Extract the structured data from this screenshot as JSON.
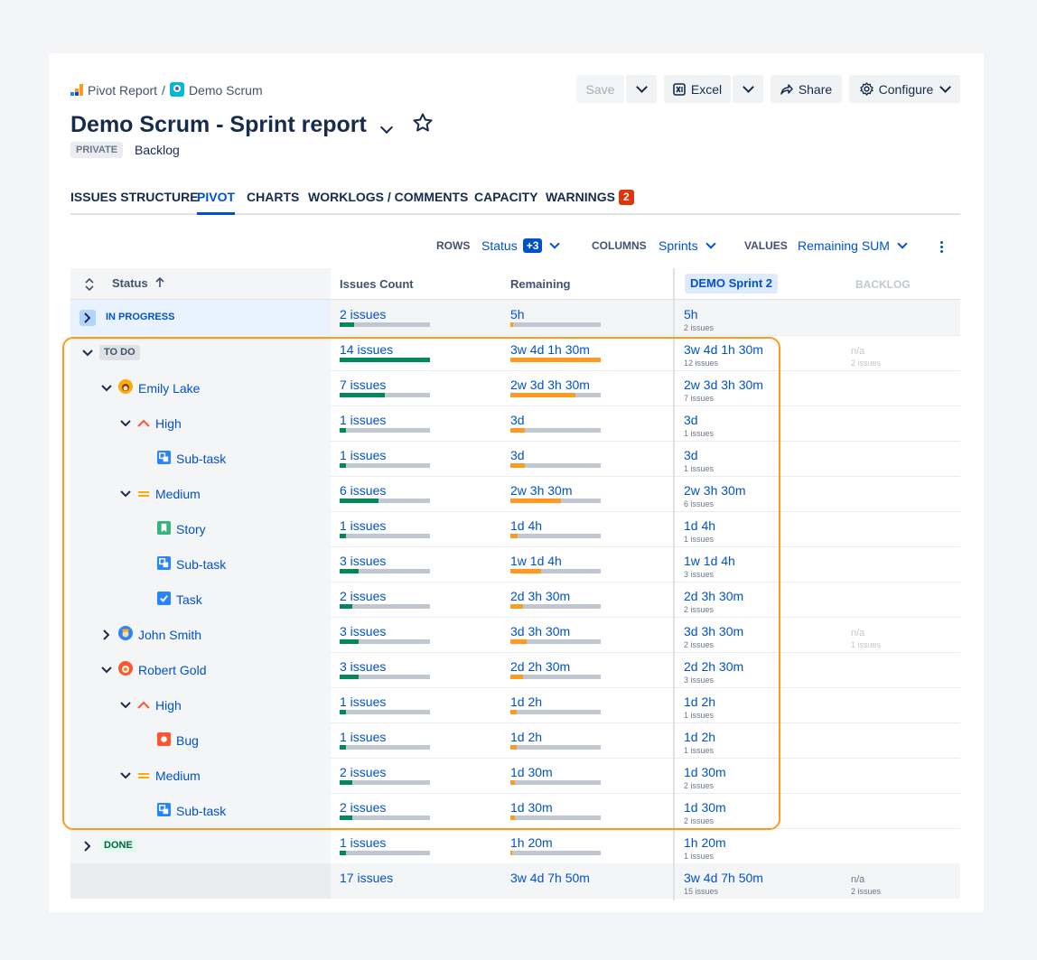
{
  "breadcrumb": {
    "root": "Pivot Report",
    "separator": "/",
    "project": "Demo Scrum"
  },
  "toolbar": {
    "save": "Save",
    "excel": "Excel",
    "share": "Share",
    "configure": "Configure"
  },
  "report": {
    "title": "Demo Scrum - Sprint report",
    "visibility": "PRIVATE",
    "board": "Backlog"
  },
  "tabs": [
    "ISSUES STRUCTURE",
    "PIVOT",
    "CHARTS",
    "WORKLOGS / COMMENTS",
    "CAPACITY",
    "WARNINGS"
  ],
  "warnings_count": "2",
  "controls": {
    "rows_label": "ROWS",
    "rows_value": "Status",
    "rows_extra": "+3",
    "columns_label": "COLUMNS",
    "columns_value": "Sprints",
    "values_label": "VALUES",
    "values_value": "Remaining SUM"
  },
  "table": {
    "headers": {
      "status": "Status",
      "issues_count": "Issues Count",
      "remaining": "Remaining",
      "sprint": "DEMO Sprint 2",
      "backlog": "BACKLOG"
    },
    "rows": [
      {
        "label": "IN PROGRESS",
        "count": "2 issues",
        "count_fill": 0.16,
        "remaining": "5h",
        "rem_fill": 0.03,
        "sprint": "5h",
        "sprint_sub": "2 issues",
        "backlog": "",
        "backlog_sub": ""
      },
      {
        "label": "TO DO",
        "count": "14 issues",
        "count_fill": 1.0,
        "remaining": "3w 4d 1h 30m",
        "rem_fill": 1.0,
        "sprint": "3w 4d 1h 30m",
        "sprint_sub": "12 issues",
        "backlog": "n/a",
        "backlog_sub": "2 issues"
      },
      {
        "label": "Emily Lake",
        "count": "7 issues",
        "count_fill": 0.5,
        "remaining": "2w 3d 3h 30m",
        "rem_fill": 0.72,
        "sprint": "2w 3d 3h 30m",
        "sprint_sub": "7 issues",
        "backlog": "",
        "backlog_sub": ""
      },
      {
        "label": "High",
        "count": "1 issues",
        "count_fill": 0.07,
        "remaining": "3d",
        "rem_fill": 0.16,
        "sprint": "3d",
        "sprint_sub": "1 issues",
        "backlog": "",
        "backlog_sub": ""
      },
      {
        "label": "Sub-task",
        "count": "1 issues",
        "count_fill": 0.07,
        "remaining": "3d",
        "rem_fill": 0.16,
        "sprint": "3d",
        "sprint_sub": "1 issues",
        "backlog": "",
        "backlog_sub": ""
      },
      {
        "label": "Medium",
        "count": "6 issues",
        "count_fill": 0.43,
        "remaining": "2w 3h 30m",
        "rem_fill": 0.56,
        "sprint": "2w 3h 30m",
        "sprint_sub": "6 issues",
        "backlog": "",
        "backlog_sub": ""
      },
      {
        "label": "Story",
        "count": "1 issues",
        "count_fill": 0.07,
        "remaining": "1d 4h",
        "rem_fill": 0.08,
        "sprint": "1d 4h",
        "sprint_sub": "1 issues",
        "backlog": "",
        "backlog_sub": ""
      },
      {
        "label": "Sub-task",
        "count": "3 issues",
        "count_fill": 0.21,
        "remaining": "1w 1d 4h",
        "rem_fill": 0.34,
        "sprint": "1w 1d 4h",
        "sprint_sub": "3 issues",
        "backlog": "",
        "backlog_sub": ""
      },
      {
        "label": "Task",
        "count": "2 issues",
        "count_fill": 0.14,
        "remaining": "2d 3h 30m",
        "rem_fill": 0.14,
        "sprint": "2d 3h 30m",
        "sprint_sub": "2 issues",
        "backlog": "",
        "backlog_sub": ""
      },
      {
        "label": "John Smith",
        "count": "3 issues",
        "count_fill": 0.21,
        "remaining": "3d 3h 30m",
        "rem_fill": 0.18,
        "sprint": "3d 3h 30m",
        "sprint_sub": "2 issues",
        "backlog": "n/a",
        "backlog_sub": "1 issues"
      },
      {
        "label": "Robert Gold",
        "count": "3 issues",
        "count_fill": 0.21,
        "remaining": "2d 2h 30m",
        "rem_fill": 0.14,
        "sprint": "2d 2h 30m",
        "sprint_sub": "3 issues",
        "backlog": "",
        "backlog_sub": ""
      },
      {
        "label": "High",
        "count": "1 issues",
        "count_fill": 0.07,
        "remaining": "1d 2h",
        "rem_fill": 0.07,
        "sprint": "1d 2h",
        "sprint_sub": "1 issues",
        "backlog": "",
        "backlog_sub": ""
      },
      {
        "label": "Bug",
        "count": "1 issues",
        "count_fill": 0.07,
        "remaining": "1d 2h",
        "rem_fill": 0.07,
        "sprint": "1d 2h",
        "sprint_sub": "1 issues",
        "backlog": "",
        "backlog_sub": ""
      },
      {
        "label": "Medium",
        "count": "2 issues",
        "count_fill": 0.14,
        "remaining": "1d 30m",
        "rem_fill": 0.05,
        "sprint": "1d 30m",
        "sprint_sub": "2 issues",
        "backlog": "",
        "backlog_sub": ""
      },
      {
        "label": "Sub-task",
        "count": "2 issues",
        "count_fill": 0.14,
        "remaining": "1d 30m",
        "rem_fill": 0.05,
        "sprint": "1d 30m",
        "sprint_sub": "2 issues",
        "backlog": "",
        "backlog_sub": ""
      },
      {
        "label": "DONE",
        "count": "1 issues",
        "count_fill": 0.07,
        "remaining": "1h 20m",
        "rem_fill": 0.02,
        "sprint": "1h 20m",
        "sprint_sub": "1 issues",
        "backlog": "",
        "backlog_sub": ""
      }
    ],
    "totals": {
      "count": "17 issues",
      "remaining": "3w 4d 7h 50m",
      "sprint": "3w 4d 7h 50m",
      "sprint_sub": "15 issues",
      "backlog": "n/a",
      "backlog_sub": "2 issues"
    }
  },
  "colors": {
    "accent": "#0052CC",
    "highlight": "#FF991F",
    "count_bar": "#00875A",
    "remaining_bar": "#FF991F",
    "warning": "#DE350B"
  }
}
